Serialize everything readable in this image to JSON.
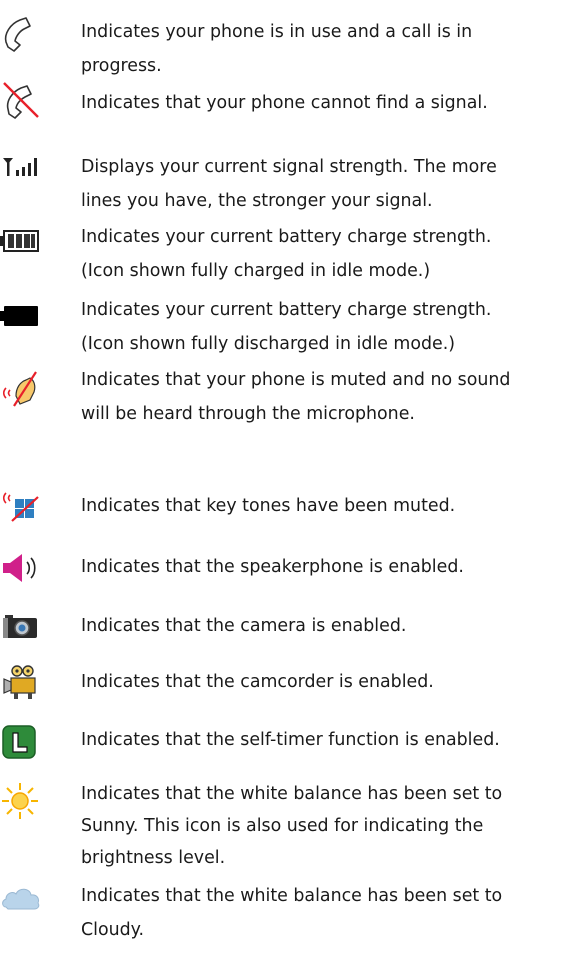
{
  "icons": [
    {
      "icon": "phone-in-use-icon",
      "lines": [
        "Indicates your phone is in use and a call is in",
        "progress."
      ]
    },
    {
      "icon": "no-signal-icon",
      "lines": [
        "Indicates that your phone cannot find a signal."
      ]
    },
    {
      "icon": "signal-strength-icon",
      "lines": [
        "Displays your current signal strength. The more",
        "lines you have, the stronger your signal."
      ]
    },
    {
      "icon": "battery-full-icon",
      "lines": [
        "Indicates your current battery charge strength.",
        "(Icon shown fully charged in idle mode.)"
      ]
    },
    {
      "icon": "battery-empty-icon",
      "lines": [
        "Indicates your current battery charge strength.",
        "(Icon shown fully discharged in idle mode.)"
      ]
    },
    {
      "icon": "mute-icon",
      "lines": [
        "Indicates that your phone is muted and no sound",
        "will be heard through the microphone."
      ]
    },
    {
      "icon": "key-tones-muted-icon",
      "lines": [
        "Indicates that key tones have been muted."
      ]
    },
    {
      "icon": "speakerphone-icon",
      "lines": [
        "Indicates that the speakerphone is enabled."
      ]
    },
    {
      "icon": "camera-icon",
      "lines": [
        "Indicates that the camera is enabled."
      ]
    },
    {
      "icon": "camcorder-icon",
      "lines": [
        "Indicates that the camcorder is enabled."
      ]
    },
    {
      "icon": "self-timer-icon",
      "lines": [
        "Indicates that the self-timer function is enabled."
      ]
    },
    {
      "icon": "sunny-icon",
      "lines": [
        "Indicates that the white balance has been set to",
        "Sunny. This icon is also used for indicating the",
        "brightness level."
      ]
    },
    {
      "icon": "cloudy-icon",
      "lines": [
        "Indicates that the white balance has been set to",
        "Cloudy."
      ]
    }
  ],
  "colors": {
    "text": "#1a1a1a",
    "red": "#e8202a",
    "green": "#2e8b3a",
    "sun": "#f7b500",
    "cloud": "#b9d4ea"
  }
}
